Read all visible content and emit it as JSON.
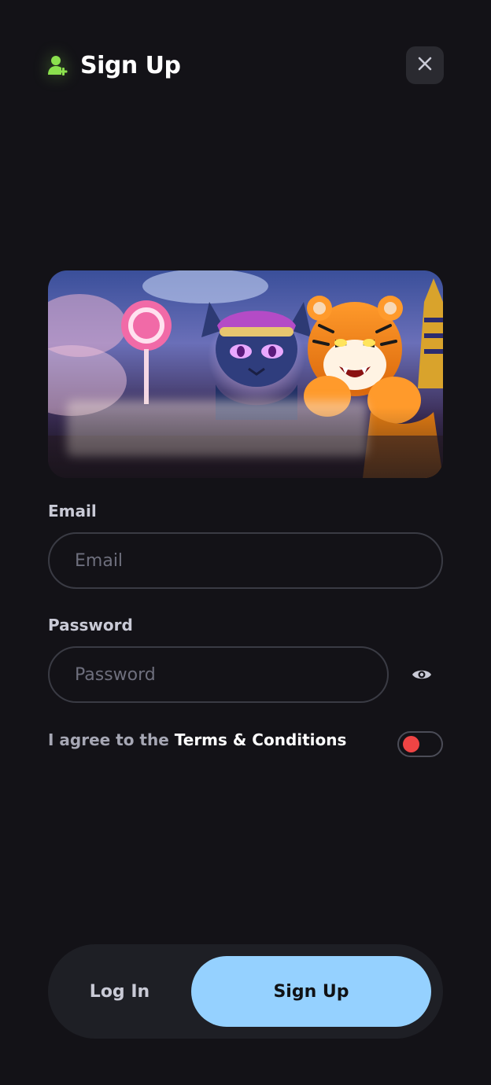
{
  "header": {
    "title": "Sign Up",
    "icon": "user-plus-icon",
    "accent_color": "#8be04e"
  },
  "close": {
    "icon": "close-icon"
  },
  "banner": {
    "image": "promo-banner-cat-tiger-characters"
  },
  "email": {
    "label": "Email",
    "placeholder": "Email",
    "value": ""
  },
  "password": {
    "label": "Password",
    "placeholder": "Password",
    "value": "",
    "toggle_icon": "eye-icon"
  },
  "terms": {
    "prefix": "I agree to the ",
    "link": "Terms & Conditions",
    "toggle_state": "off",
    "toggle_color": "#ef4444"
  },
  "tabs": {
    "login": "Log In",
    "signup": "Sign Up",
    "active": "signup",
    "active_color": "#95d1ff"
  }
}
